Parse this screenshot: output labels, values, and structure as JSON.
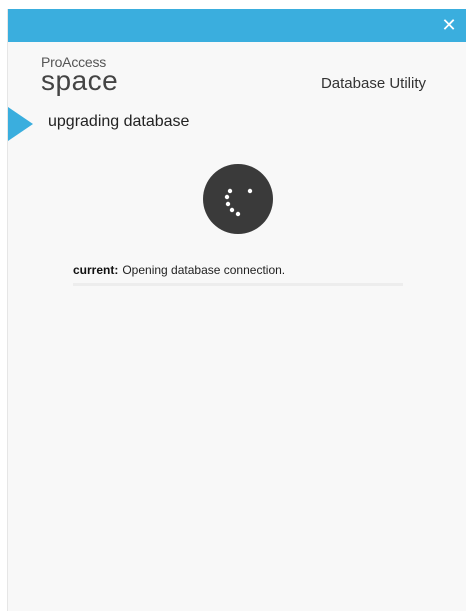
{
  "window": {
    "close_glyph": "✕",
    "accent_color": "#3aaede"
  },
  "logo": {
    "line1": "ProAccess",
    "line2": "space"
  },
  "app_title": "Database Utility",
  "step": {
    "label": "upgrading database"
  },
  "spinner": {
    "icon": "loading-spinner-icon"
  },
  "status": {
    "label": "current:",
    "text": "Opening database connection."
  }
}
